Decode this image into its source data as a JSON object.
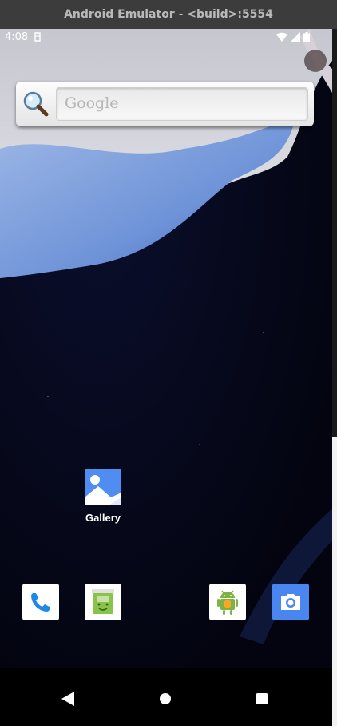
{
  "window": {
    "title": "Android Emulator - <build>:5554"
  },
  "statusbar": {
    "time": "4:08"
  },
  "search": {
    "placeholder": "Google"
  },
  "home_apps": [
    {
      "label": "Gallery"
    }
  ],
  "dock": [
    {
      "icon": "phone-icon"
    },
    {
      "icon": "messaging-icon"
    },
    {
      "icon": "android-app-icon"
    },
    {
      "icon": "camera-icon"
    }
  ],
  "colors": {
    "screen_bg": "#05071a",
    "gallery_blue": "#4f8ef0",
    "camera_blue": "#4a86f0",
    "phone_blue": "#1e88e5"
  }
}
